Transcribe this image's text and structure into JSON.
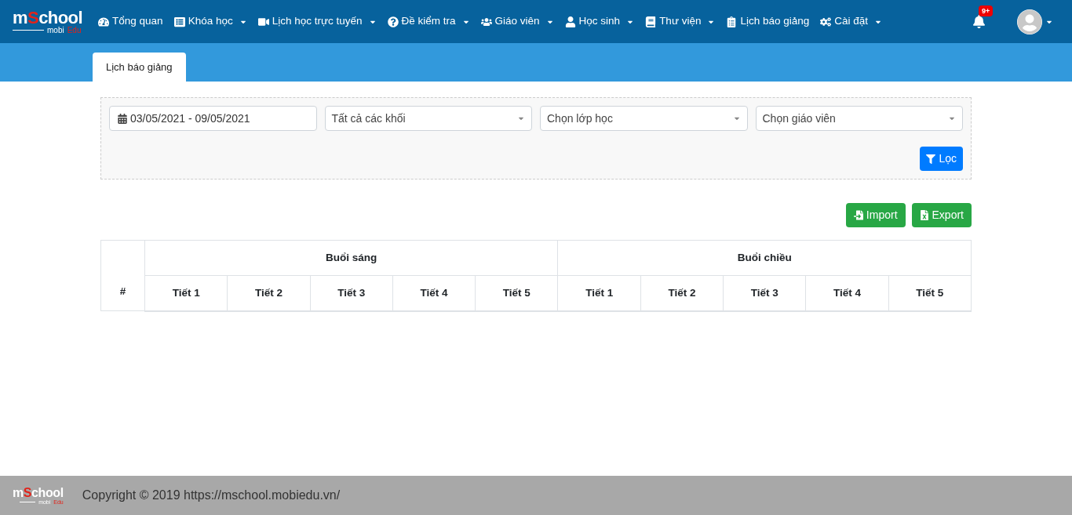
{
  "logo": {
    "title_parts": [
      "m",
      "S",
      "chool"
    ],
    "subtitle_parts": [
      "mobi",
      "Edu"
    ]
  },
  "nav": [
    {
      "label": "Tổng quan",
      "dropdown": false
    },
    {
      "label": "Khóa học",
      "dropdown": true
    },
    {
      "label": "Lịch học trực tuyến",
      "dropdown": true
    },
    {
      "label": "Đề kiểm tra",
      "dropdown": true
    },
    {
      "label": "Giáo viên",
      "dropdown": true
    },
    {
      "label": "Học sinh",
      "dropdown": true
    },
    {
      "label": "Thư viện",
      "dropdown": true
    },
    {
      "label": "Lịch báo giảng",
      "dropdown": false
    },
    {
      "label": "Cài đặt",
      "dropdown": true
    }
  ],
  "notifications": {
    "badge": "9+"
  },
  "tabs": [
    {
      "label": "Lịch báo giảng",
      "selected": true
    }
  ],
  "filters": {
    "date_range": "03/05/2021 - 09/05/2021",
    "selects": [
      "Tất cả các khối",
      "Chọn lớp học",
      "Chọn giáo viên"
    ],
    "filter_button": "Lọc"
  },
  "actions": [
    "Import",
    "Export"
  ],
  "table": {
    "index_header": "#",
    "groups": [
      {
        "label": "Buổi sáng",
        "periods": [
          "Tiết 1",
          "Tiết 2",
          "Tiết 3",
          "Tiết 4",
          "Tiết 5"
        ]
      },
      {
        "label": "Buổi chiều",
        "periods": [
          "Tiết 1",
          "Tiết 2",
          "Tiết 3",
          "Tiết 4",
          "Tiết 5"
        ]
      }
    ]
  },
  "footer": {
    "logo": {
      "title_parts": [
        "m",
        "S",
        "chool"
      ],
      "subtitle_parts": [
        "mobi",
        "Edu"
      ]
    },
    "copyright": "Copyright © 2019 https://mschool.mobiedu.vn/"
  }
}
